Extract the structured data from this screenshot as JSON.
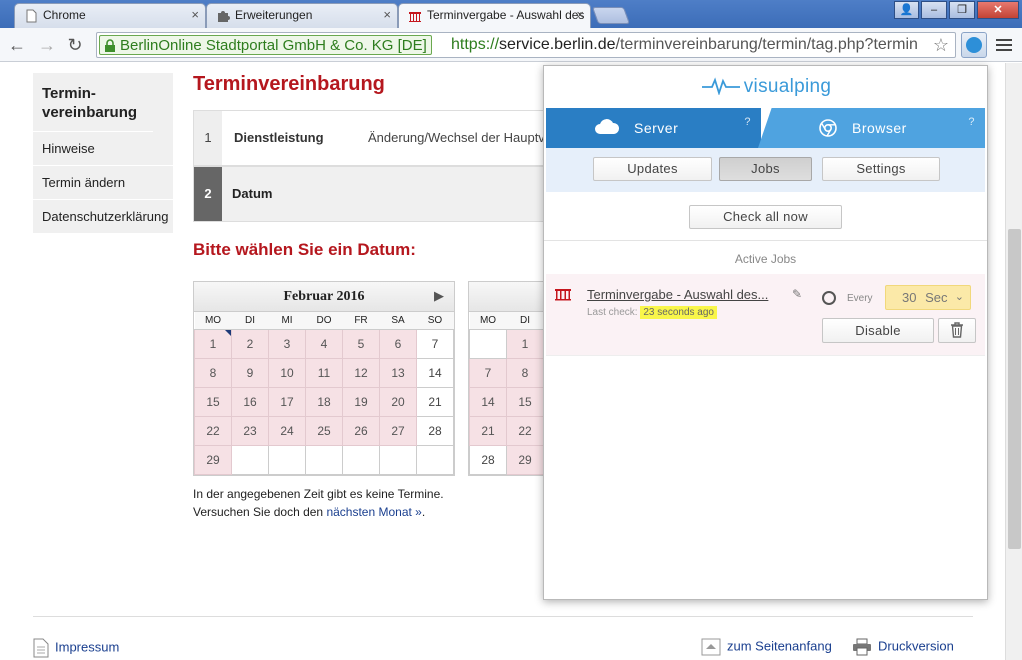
{
  "browser": {
    "tabs": [
      {
        "title": "Chrome",
        "close": "×"
      },
      {
        "title": "Erweiterungen",
        "close": "×"
      },
      {
        "title": "Terminvergabe - Auswahl des",
        "close": "×"
      }
    ],
    "window_controls": {
      "user": "👤",
      "minimize": "–",
      "maximize": "❐",
      "close": "✕"
    },
    "nav": {
      "back": "←",
      "forward": "→",
      "reload": "↻"
    },
    "ev_label": "BerlinOnline Stadtportal GmbH & Co. KG [DE]",
    "url_scheme": "https://",
    "url_host": "service.berlin.de",
    "url_path": "/terminvereinbarung/termin/tag.php?termin",
    "star": "☆"
  },
  "sidebar": {
    "title": "Termin-vereinbarung",
    "items": [
      {
        "label": "Hinweise"
      },
      {
        "label": "Termin ändern"
      },
      {
        "label": "Datenschutzerklärung"
      }
    ]
  },
  "main": {
    "title": "Terminvereinbarung",
    "steps": [
      {
        "num": "1",
        "label": "Dienstleistung",
        "value": "Änderung/Wechsel der Hauptv"
      },
      {
        "num": "2",
        "label": "Datum",
        "value": ""
      }
    ],
    "subtitle": "Bitte wählen Sie ein Datum:",
    "calendar_left": {
      "month": "Februar 2016",
      "next": "▶",
      "weekdays": [
        "MO",
        "DI",
        "MI",
        "DO",
        "FR",
        "SA",
        "SO"
      ],
      "rows": [
        [
          "1",
          "2",
          "3",
          "4",
          "5",
          "6",
          "7"
        ],
        [
          "8",
          "9",
          "10",
          "11",
          "12",
          "13",
          "14"
        ],
        [
          "15",
          "16",
          "17",
          "18",
          "19",
          "20",
          "21"
        ],
        [
          "22",
          "23",
          "24",
          "25",
          "26",
          "27",
          "28"
        ],
        [
          "29",
          "",
          "",
          "",
          "",
          "",
          ""
        ]
      ]
    },
    "calendar_right": {
      "weekdays": [
        "MO",
        "DI"
      ],
      "rows": [
        [
          "",
          "1"
        ],
        [
          "7",
          "8"
        ],
        [
          "14",
          "15"
        ],
        [
          "21",
          "22"
        ],
        [
          "28",
          "29"
        ]
      ]
    },
    "notice_line1": "In der angegebenen Zeit gibt es keine Termine.",
    "notice_line2_prefix": "Versuchen Sie doch den ",
    "notice_link": "nächsten Monat »",
    "notice_line2_suffix": "."
  },
  "footer": {
    "impressum": "Impressum",
    "top": "zum Seitenanfang",
    "print": "Druckversion"
  },
  "visualping": {
    "logo": "visualping",
    "modes": [
      {
        "label": "Server",
        "help": "?"
      },
      {
        "label": "Browser",
        "help": "?"
      }
    ],
    "tabs": [
      {
        "label": "Updates"
      },
      {
        "label": "Jobs"
      },
      {
        "label": "Settings"
      }
    ],
    "check_all": "Check all now",
    "active_jobs_title": "Active Jobs",
    "job": {
      "title": "Terminvergabe - Auswahl des...",
      "last_check_label": "Last check:",
      "last_check_value": "23 seconds ago",
      "every_label": "Every",
      "interval_value": "30",
      "interval_unit": "Sec",
      "disable_label": "Disable"
    }
  },
  "colors": {
    "berlin_red": "#b5171e",
    "vp_server": "#2a7ec4",
    "vp_browser": "#4fa3e0",
    "vp_highlight": "#f9f64a",
    "calendar_unavailable": "#f6e1e5"
  }
}
